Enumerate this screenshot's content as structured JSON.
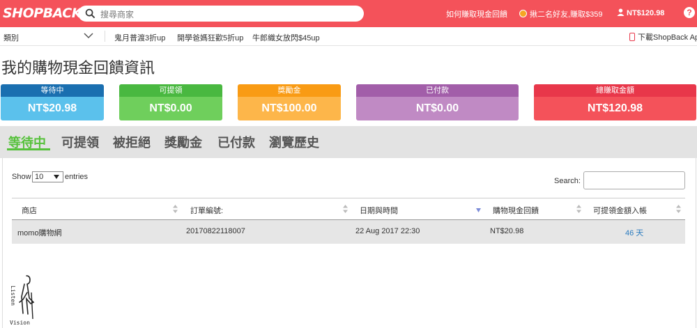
{
  "header": {
    "logo": "SHOPBACK",
    "search_placeholder": "搜尋商家",
    "how_it_works": "如何賺取現金回饋",
    "referral": "揪二名好友,賺取$359",
    "balance": "NT$120.98",
    "help": "?"
  },
  "subnav": {
    "category": "類別",
    "promos": [
      "鬼月普渡3折up",
      "開學爸媽狂歡5折up",
      "牛郎織女放閃$45up"
    ],
    "download": "下載ShopBack App"
  },
  "page": {
    "title": "我的購物現金回饋資訊"
  },
  "cards": [
    {
      "label": "等待中",
      "value": "NT$20.98",
      "head_color": "#1a6fb0",
      "body_color": "#5bc1ec"
    },
    {
      "label": "可提領",
      "value": "NT$0.00",
      "head_color": "#49b840",
      "body_color": "#6fcf5c"
    },
    {
      "label": "獎勵金",
      "value": "NT$100.00",
      "head_color": "#f99b14",
      "body_color": "#fdb64a"
    },
    {
      "label": "已付款",
      "value": "NT$0.00",
      "head_color": "#a25ea9",
      "body_color": "#c08ac4"
    },
    {
      "label": "總賺取金額",
      "value": "NT$120.98",
      "head_color": "#e8374a",
      "body_color": "#f4525a"
    }
  ],
  "tabs": [
    "等待中",
    "可提領",
    "被拒絕",
    "獎勵金",
    "已付款",
    "瀏覽歷史"
  ],
  "table": {
    "show_label": "Show",
    "entries_value": "10",
    "entries_label": "entries",
    "search_label": "Search:",
    "columns": [
      "商店",
      "訂單編號:",
      "日期與時間",
      "購物現金回饋",
      "可提領金額入帳"
    ],
    "rows": [
      {
        "store": "momo購物網",
        "order_no": "20170822118007",
        "datetime": "22 Aug 2017 22:30",
        "cashback": "NT$20.98",
        "days": "46 天"
      }
    ]
  },
  "watermark": "Listen Vision"
}
